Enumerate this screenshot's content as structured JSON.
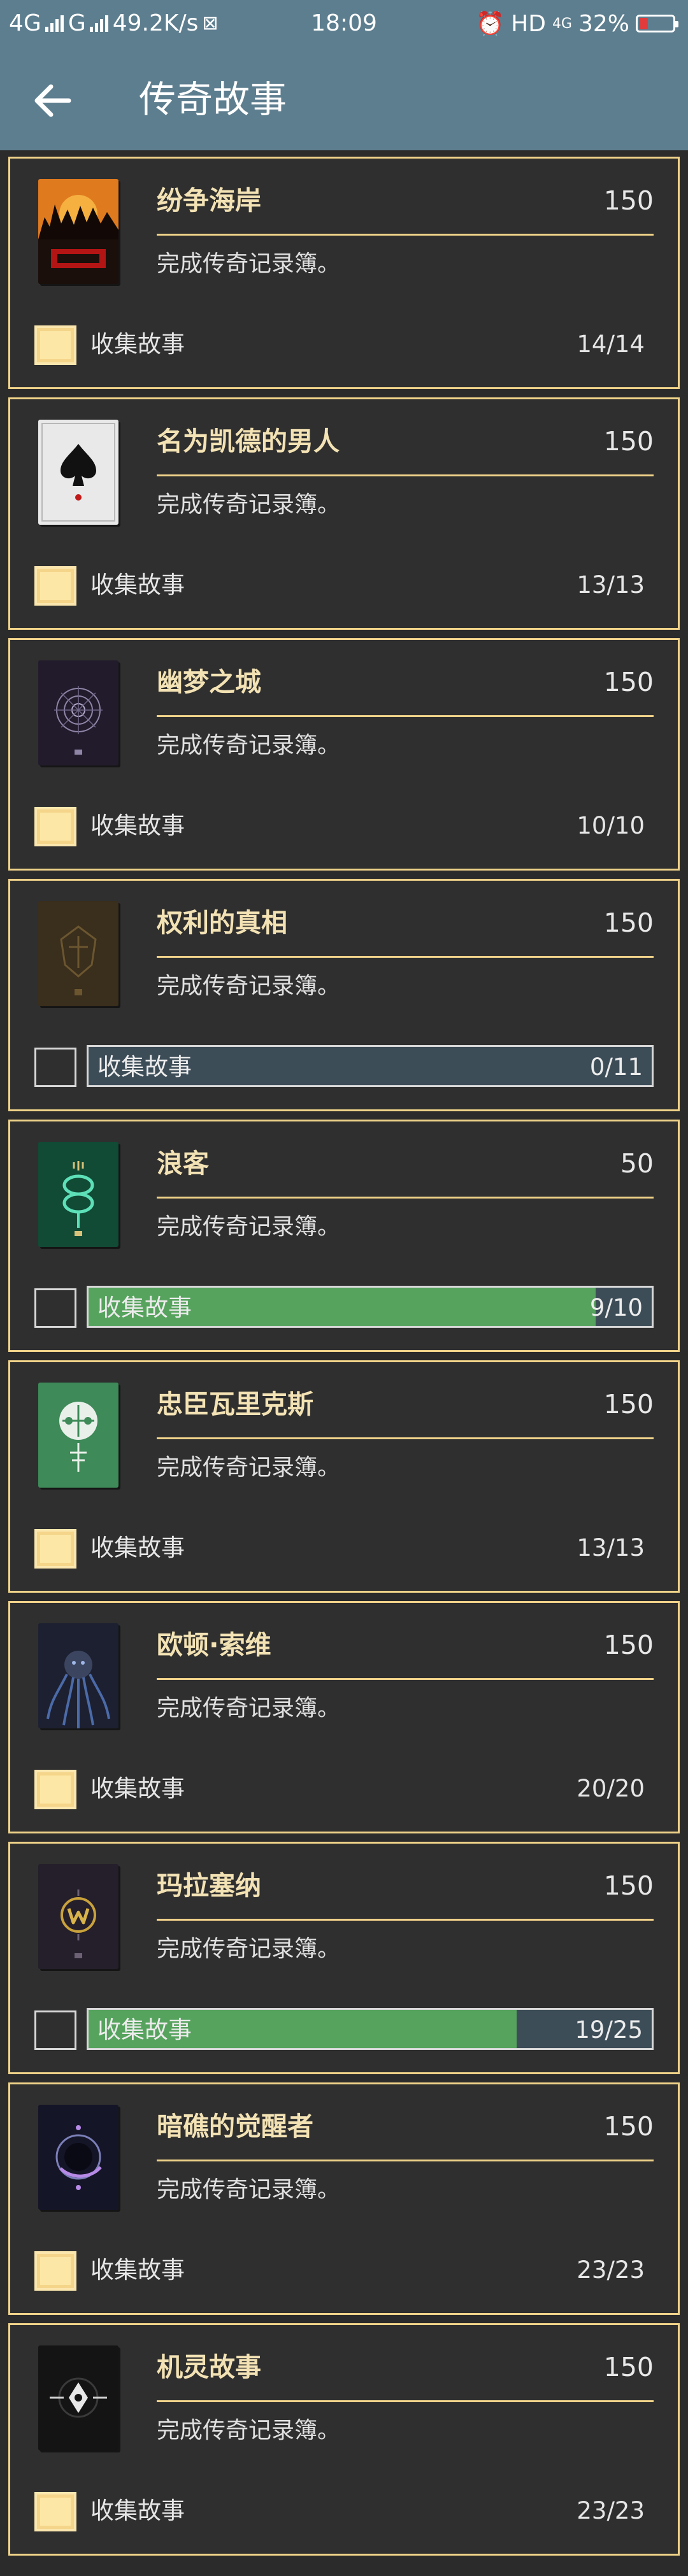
{
  "statusbar": {
    "network_left": "4G",
    "network_second": "G",
    "speed": "49.2K/s",
    "time": "18:09",
    "hd": "HD",
    "network_right": "4G",
    "battery": "32%"
  },
  "appbar": {
    "title": "传奇故事"
  },
  "cards": [
    {
      "title": "纷争海岸",
      "points": "150",
      "description": "完成传奇记录簿。",
      "progress_label": "收集故事",
      "count": "14/14",
      "complete": true,
      "progress": 1.0,
      "cover": "cover-orange-silhouettes"
    },
    {
      "title": "名为凯德的男人",
      "points": "150",
      "description": "完成传奇记录簿。",
      "progress_label": "收集故事",
      "count": "13/13",
      "complete": true,
      "progress": 1.0,
      "cover": "cover-white-spade"
    },
    {
      "title": "幽梦之城",
      "points": "150",
      "description": "完成传奇记录簿。",
      "progress_label": "收集故事",
      "count": "10/10",
      "complete": true,
      "progress": 1.0,
      "cover": "cover-dark-purple-mandala"
    },
    {
      "title": "权利的真相",
      "points": "150",
      "description": "完成传奇记录簿。",
      "progress_label": "收集故事",
      "count": "0/11",
      "complete": false,
      "progress": 0.0,
      "cover": "cover-brown-emblem"
    },
    {
      "title": "浪客",
      "points": "50",
      "description": "完成传奇记录簿。",
      "progress_label": "收集故事",
      "count": "9/10",
      "complete": false,
      "progress": 0.9,
      "cover": "cover-green-serpent"
    },
    {
      "title": "忠臣瓦里克斯",
      "points": "150",
      "description": "完成传奇记录簿。",
      "progress_label": "收集故事",
      "count": "13/13",
      "complete": true,
      "progress": 1.0,
      "cover": "cover-green-cipher"
    },
    {
      "title": "欧顿·索维",
      "points": "150",
      "description": "完成传奇记录簿。",
      "progress_label": "收集故事",
      "count": "20/20",
      "complete": true,
      "progress": 1.0,
      "cover": "cover-dark-tentacle"
    },
    {
      "title": "玛拉塞纳",
      "points": "150",
      "description": "完成传奇记录簿。",
      "progress_label": "收集故事",
      "count": "19/25",
      "complete": false,
      "progress": 0.76,
      "cover": "cover-dark-gold-w"
    },
    {
      "title": "暗礁的觉醒者",
      "points": "150",
      "description": "完成传奇记录簿。",
      "progress_label": "收集故事",
      "count": "23/23",
      "complete": true,
      "progress": 1.0,
      "cover": "cover-dark-moon"
    },
    {
      "title": "机灵故事",
      "points": "150",
      "description": "完成传奇记录簿。",
      "progress_label": "收集故事",
      "count": "23/23",
      "complete": true,
      "progress": 1.0,
      "cover": "cover-black-ghost"
    }
  ],
  "colors": {
    "appbar": "#5d7e8f",
    "card_border": "#f0d38a",
    "checkbox_fill": "#fde7a6",
    "progress_fill": "#56a35e",
    "progress_track": "#3d4d58"
  }
}
